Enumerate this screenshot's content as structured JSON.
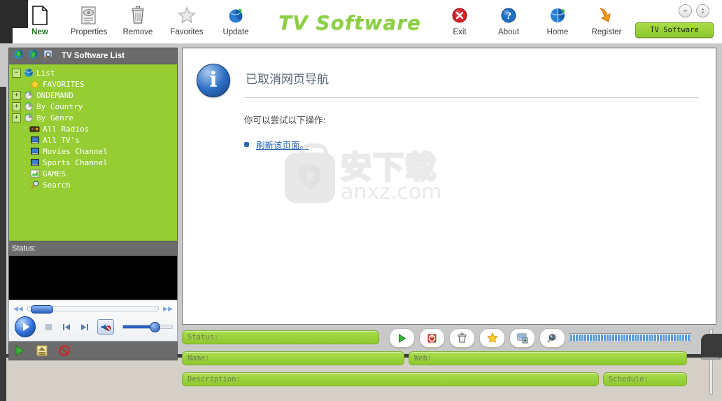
{
  "window": {
    "title": "TV Software",
    "minimize_label": "–",
    "restore_label": "↕",
    "tab_label": "TV Software"
  },
  "toolbar": {
    "items": [
      {
        "label": "New",
        "icon": "new-document-icon",
        "accent": true
      },
      {
        "label": "Properties",
        "icon": "properties-icon",
        "accent": false
      },
      {
        "label": "Remove",
        "icon": "trash-icon",
        "accent": false
      },
      {
        "label": "Favorites",
        "icon": "star-icon",
        "accent": false
      },
      {
        "label": "Update",
        "icon": "globe-update-icon",
        "accent": false
      },
      {
        "label": "Exit",
        "icon": "exit-icon",
        "accent": false
      },
      {
        "label": "About",
        "icon": "help-icon",
        "accent": false
      },
      {
        "label": "Home",
        "icon": "home-globe-icon",
        "accent": false
      },
      {
        "label": "Register",
        "icon": "register-arrow-icon",
        "accent": false
      }
    ]
  },
  "sidebar": {
    "header": {
      "title": "TV Software List",
      "icons": [
        "download-icon",
        "upload-icon",
        "preview-search-icon"
      ]
    },
    "tree": [
      {
        "label": "List",
        "icon": "globe-icon",
        "depth": 0,
        "expander": "minus"
      },
      {
        "label": "FAVORITES",
        "icon": "star-icon",
        "depth": 1,
        "expander": "none"
      },
      {
        "label": "ONDEMAND",
        "icon": "refresh-icon",
        "depth": 1,
        "expander": "plus"
      },
      {
        "label": "By Country",
        "icon": "refresh-icon",
        "depth": 1,
        "expander": "plus"
      },
      {
        "label": "By Genre",
        "icon": "refresh-icon",
        "depth": 1,
        "expander": "plus"
      },
      {
        "label": "All Radios",
        "icon": "radio-icon",
        "depth": 1,
        "expander": "none"
      },
      {
        "label": "All TV's",
        "icon": "tv-icon",
        "depth": 1,
        "expander": "none"
      },
      {
        "label": "Movies Channel",
        "icon": "tv-icon",
        "depth": 1,
        "expander": "none"
      },
      {
        "label": "Sports Channel",
        "icon": "tv-icon",
        "depth": 1,
        "expander": "none"
      },
      {
        "label": "GAMES",
        "icon": "games-icon",
        "depth": 1,
        "expander": "none"
      },
      {
        "label": "Search",
        "icon": "magnifier-icon",
        "depth": 1,
        "expander": "none"
      }
    ],
    "status_label": "Status:",
    "footer_buttons": [
      "play-icon",
      "eject-icon",
      "record-stop-icon"
    ]
  },
  "player": {
    "rewind_icon": "rewind-icon",
    "forward_icon": "fast-forward-icon",
    "play_icon": "play-icon",
    "stop_icon": "stop-icon",
    "previous_icon": "previous-track-icon",
    "next_icon": "next-track-icon",
    "mute_icon": "mute-icon"
  },
  "content": {
    "icon": "info-icon",
    "icon_glyph": "i",
    "title": "已取消网页导航",
    "subtitle": "你可以尝试以下操作:",
    "actions": [
      {
        "label": "刷新该页面。"
      }
    ],
    "watermark": {
      "cn": "安下载",
      "en": "anxz.com",
      "badge": "安"
    }
  },
  "form": {
    "status_placeholder": "Status:",
    "name_placeholder": "Name:",
    "web_placeholder": "Web:",
    "description_placeholder": "Description:",
    "schedule_placeholder": "Schedule:",
    "buttons": [
      {
        "name": "play",
        "icon": "play-icon"
      },
      {
        "name": "record",
        "icon": "record-icon"
      },
      {
        "name": "delete",
        "icon": "trash-icon"
      },
      {
        "name": "favorite",
        "icon": "star-icon"
      },
      {
        "name": "add-channel",
        "icon": "add-screen-icon"
      },
      {
        "name": "search",
        "icon": "search-ball-icon"
      }
    ],
    "meter_segments": 43
  },
  "colors": {
    "brand_green": "#8ccf45",
    "panel_green": "#95cd32",
    "field_green": "#a9dd4e",
    "header_gray": "#6b6b6b",
    "meter_blue": "#5b9bd5",
    "link_blue": "#1f5fb0"
  }
}
